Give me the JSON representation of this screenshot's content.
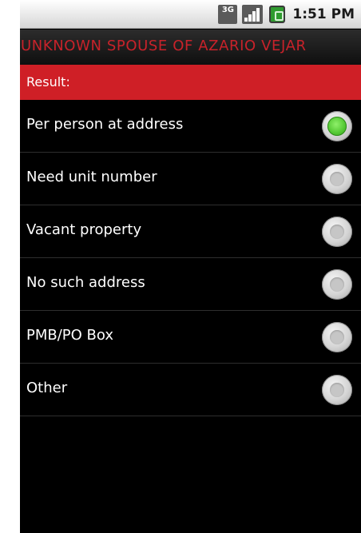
{
  "status_bar": {
    "network": "3G",
    "time": "1:51 PM",
    "icons": [
      "3g-data-icon",
      "signal-strength-icon",
      "battery-icon"
    ],
    "battery_color": "#2f9b2f"
  },
  "title_bar": {
    "title": "UNKNOWN SPOUSE OF AZARIO VEJAR",
    "title_color": "#c8222a"
  },
  "section": {
    "label": "Result:",
    "background": "#cf1f26"
  },
  "options": [
    {
      "label": "Per person at address",
      "selected": true
    },
    {
      "label": "Need unit number",
      "selected": false
    },
    {
      "label": "Vacant property",
      "selected": false
    },
    {
      "label": "No such address",
      "selected": false
    },
    {
      "label": "PMB/PO Box",
      "selected": false
    },
    {
      "label": "Other",
      "selected": false
    }
  ],
  "colors": {
    "radio_selected": "#55c934",
    "list_background": "#000000"
  }
}
